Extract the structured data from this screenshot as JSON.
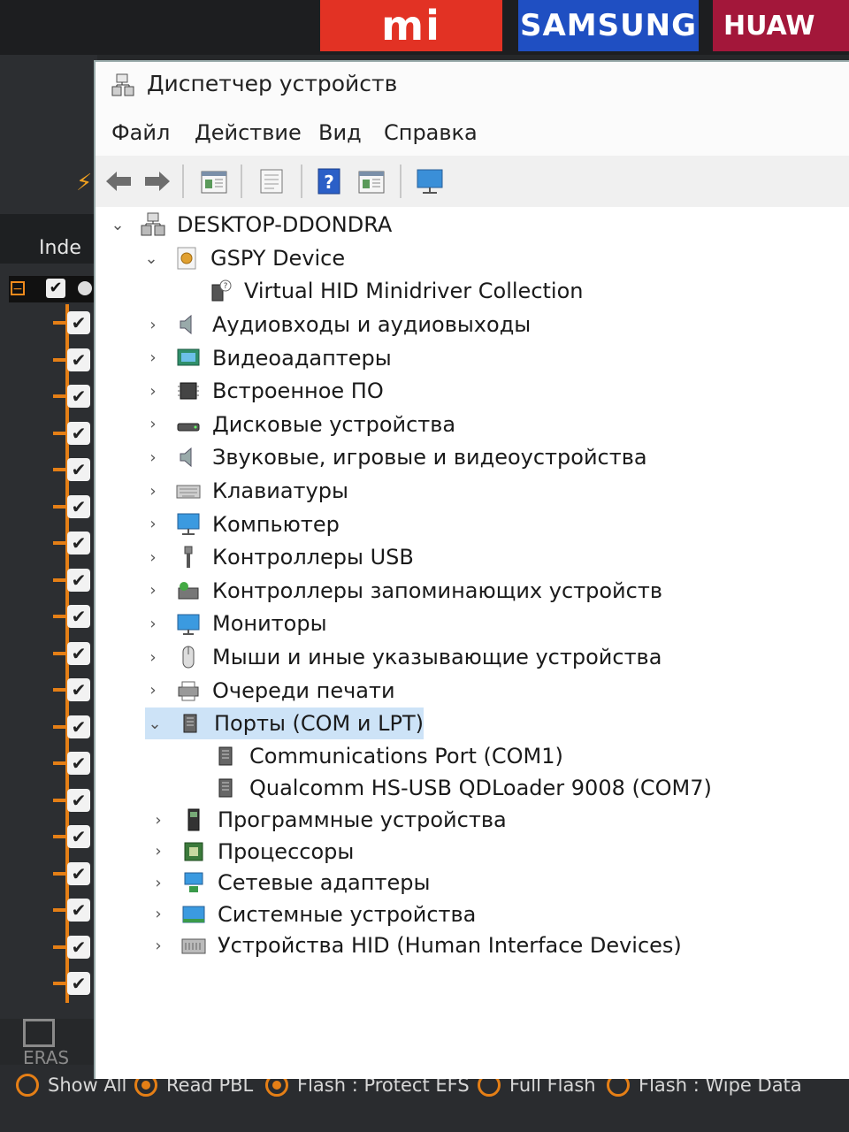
{
  "brands": {
    "mi": "mi",
    "samsung": "SAMSUNG",
    "huawei": "HUAW"
  },
  "tool": {
    "index_header": "Inde",
    "erase_label": "ERAS",
    "options": [
      {
        "label": "Show All",
        "checked": false
      },
      {
        "label": "Read PBL",
        "checked": true
      },
      {
        "label": "Flash : Protect EFS",
        "checked": true
      },
      {
        "label": "Full Flash",
        "checked": false
      },
      {
        "label": "Flash : Wipe Data",
        "checked": false
      }
    ],
    "accent_color": "#e57f16"
  },
  "window": {
    "title": "Диспетчер устройств",
    "menu": [
      "Файл",
      "Действие",
      "Вид",
      "Справка"
    ],
    "toolbar_icons": [
      "back-arrow-icon",
      "forward-arrow-icon",
      "properties-icon",
      "show-hidden-icon",
      "help-icon",
      "update-driver-icon",
      "scan-hardware-icon"
    ]
  },
  "tree": {
    "root": "DESKTOP-DDONDRA",
    "gspy": "GSPY Device",
    "gspy_child": "Virtual HID Minidriver Collection",
    "categories": [
      "Аудиовходы и аудиовыходы",
      "Видеоадаптеры",
      "Встроенное ПО",
      "Дисковые устройства",
      "Звуковые, игровые и видеоустройства",
      "Клавиатуры",
      "Компьютер",
      "Контроллеры USB",
      "Контроллеры запоминающих устройств",
      "Мониторы",
      "Мыши и иные указывающие устройства",
      "Очереди печати"
    ],
    "ports": "Порты (COM и LPT)",
    "port_children": [
      "Communications Port (COM1)",
      "Qualcomm HS-USB QDLoader 9008 (COM7)"
    ],
    "categories_after": [
      "Программные устройства",
      "Процессоры",
      "Сетевые адаптеры",
      "Системные устройства",
      "Устройства HID (Human Interface Devices)"
    ]
  }
}
